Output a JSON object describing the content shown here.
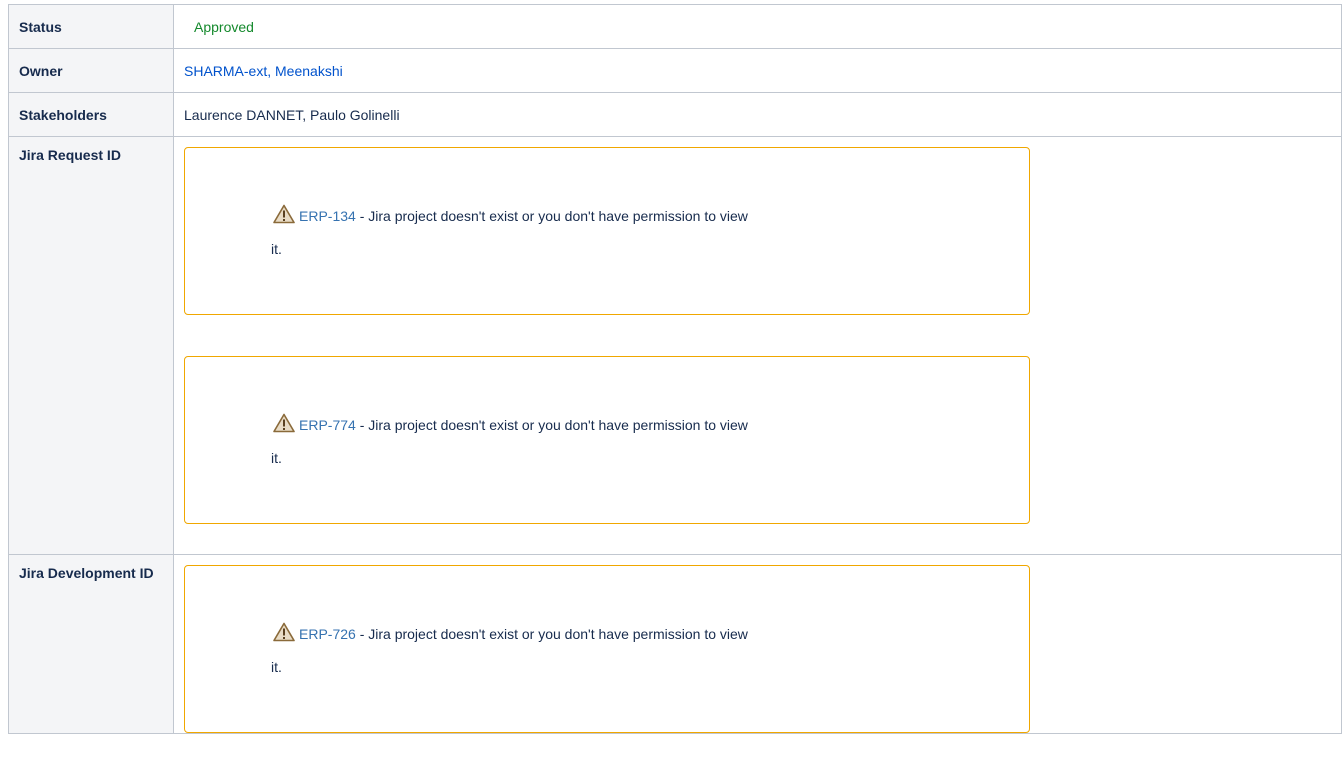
{
  "rows": {
    "status": {
      "label": "Status",
      "value": "Approved"
    },
    "owner": {
      "label": "Owner",
      "value": "SHARMA-ext, Meenakshi"
    },
    "stakeholders": {
      "label": "Stakeholders",
      "value": "Laurence DANNET, Paulo Golinelli"
    },
    "jira_request": {
      "label": "Jira Request ID",
      "issues": [
        {
          "key": "ERP-134",
          "message": " - Jira project doesn't exist or you don't have permission to view",
          "tail": "it."
        },
        {
          "key": "ERP-774",
          "message": " - Jira project doesn't exist or you don't have permission to view",
          "tail": "it."
        }
      ]
    },
    "jira_development": {
      "label": "Jira Development ID",
      "issues": [
        {
          "key": "ERP-726",
          "message": " - Jira project doesn't exist or you don't have permission to view",
          "tail": "it."
        }
      ]
    }
  },
  "colors": {
    "status_green": "#14892c",
    "link_blue": "#0052cc",
    "issue_key_blue": "#3572b0",
    "panel_border": "#f0a700",
    "header_bg": "#f4f5f7",
    "table_border": "#c1c7d0"
  },
  "icons": {
    "warning": "warning-triangle-icon"
  }
}
